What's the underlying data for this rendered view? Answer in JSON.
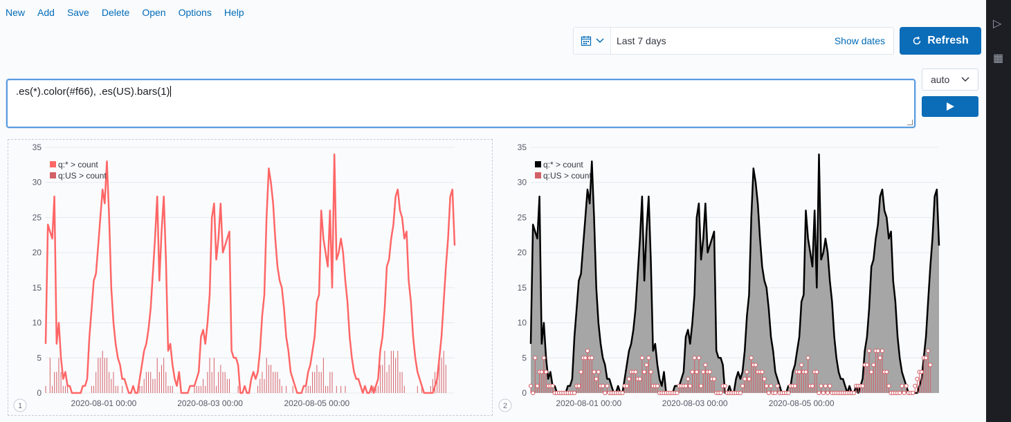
{
  "menu": {
    "items": [
      "New",
      "Add",
      "Save",
      "Delete",
      "Open",
      "Options",
      "Help"
    ]
  },
  "time": {
    "range_label": "Last 7 days",
    "show_dates_label": "Show dates",
    "refresh_label": "Refresh"
  },
  "expression": {
    "value": ".es(*).color(#f66), .es(US).bars(1)"
  },
  "interval": {
    "value": "auto"
  },
  "colors": {
    "accent": "#0b6cb8",
    "series_all_panel1": "#ff6666",
    "series_us": "#d36067",
    "series_all_panel2": "#000000",
    "fill_panel2": "#a6a6a6"
  },
  "chart_data": [
    {
      "type": "line",
      "panel_number": "1",
      "ylim": [
        0,
        35
      ],
      "yticks": [
        0,
        5,
        10,
        15,
        20,
        25,
        30,
        35
      ],
      "xtick_labels": [
        "2020-08-01 00:00",
        "2020-08-03 00:00",
        "2020-08-05 00:00"
      ],
      "grid": true,
      "legend": "top-left",
      "series": [
        {
          "name": "q:* > count",
          "style": "line",
          "color": "#ff6666",
          "values": [
            7,
            24,
            23,
            22,
            28,
            7,
            10,
            5,
            2,
            3,
            1,
            1,
            0,
            0,
            0,
            0,
            0,
            1,
            1,
            2,
            8,
            12,
            16,
            17,
            21,
            25,
            29,
            27,
            33,
            25,
            15,
            10,
            7,
            5,
            4,
            2,
            2,
            1,
            0,
            0,
            1,
            0,
            0,
            2,
            4,
            6,
            7,
            9,
            12,
            17,
            22,
            28,
            16,
            23,
            28,
            19,
            6,
            7,
            4,
            2,
            1,
            3,
            0,
            0,
            0,
            0,
            1,
            1,
            1,
            2,
            3,
            8,
            9,
            7,
            10,
            14,
            25,
            27,
            19,
            22,
            27,
            20,
            21,
            22,
            23,
            6,
            5,
            5,
            4,
            0,
            0,
            1,
            0,
            0,
            2,
            3,
            2,
            3,
            6,
            11,
            14,
            25,
            32,
            30,
            27,
            22,
            18,
            16,
            15,
            12,
            8,
            6,
            3,
            2,
            1,
            0,
            0,
            0,
            1,
            1,
            3,
            4,
            6,
            8,
            13,
            14,
            26,
            22,
            20,
            18,
            26,
            15,
            34,
            19,
            20,
            22,
            20,
            16,
            13,
            8,
            5,
            3,
            2,
            2,
            1,
            0,
            1,
            0,
            0,
            1,
            0,
            1,
            2,
            6,
            8,
            12,
            18,
            19,
            22,
            24,
            28,
            29,
            26,
            25,
            22,
            23,
            16,
            13,
            8,
            5,
            3,
            2,
            1,
            0,
            0,
            0,
            0,
            0,
            1,
            2,
            5,
            8,
            13,
            18,
            22,
            28,
            29,
            21
          ]
        },
        {
          "name": "q:US > count",
          "style": "bars",
          "color": "#d36067",
          "values": [
            1,
            0,
            5,
            1,
            3,
            3,
            5,
            3,
            1,
            1,
            1,
            0,
            0,
            0,
            0,
            0,
            0,
            0,
            0,
            0,
            0,
            1,
            1,
            3,
            5,
            5,
            6,
            5,
            5,
            3,
            2,
            3,
            1,
            1,
            0,
            1,
            0,
            0,
            0,
            0,
            0,
            0,
            0,
            1,
            1,
            2,
            3,
            3,
            3,
            2,
            2,
            5,
            3,
            4,
            5,
            3,
            1,
            1,
            1,
            0,
            0,
            0,
            0,
            0,
            0,
            0,
            0,
            0,
            1,
            1,
            1,
            1,
            2,
            1,
            3,
            5,
            3,
            5,
            1,
            3,
            4,
            3,
            3,
            2,
            2,
            0,
            0,
            0,
            1,
            1,
            0,
            0,
            0,
            0,
            0,
            0,
            0,
            1,
            2,
            3,
            2,
            5,
            4,
            4,
            3,
            3,
            3,
            2,
            1,
            0,
            1,
            0,
            0,
            1,
            0,
            0,
            0,
            0,
            0,
            1,
            1,
            1,
            3,
            3,
            4,
            3,
            3,
            5,
            1,
            1,
            3,
            3,
            0,
            1,
            0,
            1,
            0,
            1,
            0,
            0,
            0,
            0,
            0,
            0,
            0,
            0,
            0,
            0,
            0,
            1,
            1,
            1,
            1,
            4,
            4,
            6,
            3,
            4,
            6,
            6,
            5,
            6,
            3,
            3,
            1,
            0,
            0,
            0,
            0,
            0,
            1,
            0,
            1,
            0,
            0,
            0,
            1,
            2,
            3,
            3,
            5,
            5,
            6,
            4
          ]
        }
      ]
    },
    {
      "type": "area",
      "panel_number": "2",
      "ylim": [
        0,
        35
      ],
      "yticks": [
        0,
        5,
        10,
        15,
        20,
        25,
        30,
        35
      ],
      "xtick_labels": [
        "2020-08-01 00:00",
        "2020-08-03 00:00",
        "2020-08-05 00:00"
      ],
      "grid": true,
      "legend": "top-left",
      "series": [
        {
          "name": "q:* > count",
          "style": "area",
          "color": "#000000",
          "source": "same as panel 1 q:*"
        },
        {
          "name": "q:US > count",
          "style": "points",
          "color": "#d36067",
          "source": "same as panel 1 q:US"
        }
      ]
    }
  ]
}
